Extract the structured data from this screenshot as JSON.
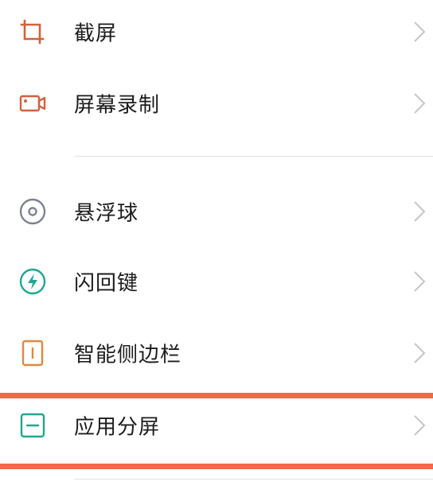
{
  "settings": {
    "items": [
      {
        "id": "screenshot",
        "label": "截屏",
        "icon": "crop-icon",
        "icon_color": "#d2613d"
      },
      {
        "id": "screen-record",
        "label": "屏幕录制",
        "icon": "video-camera-icon",
        "icon_color": "#d2613d"
      },
      {
        "id": "floating-ball",
        "label": "悬浮球",
        "icon": "floating-ball-icon",
        "icon_color": "#7d8390"
      },
      {
        "id": "flash-back-key",
        "label": "闪回键",
        "icon": "lightning-icon",
        "icon_color": "#1ea88f"
      },
      {
        "id": "smart-sidebar",
        "label": "智能侧边栏",
        "icon": "sidebar-icon",
        "icon_color": "#e2873e"
      },
      {
        "id": "split-screen",
        "label": "应用分屏",
        "icon": "split-screen-icon",
        "icon_color": "#1ea88f"
      }
    ],
    "chevron_icon": "chevron-right-icon",
    "highlight_color": "#ef6a47"
  }
}
